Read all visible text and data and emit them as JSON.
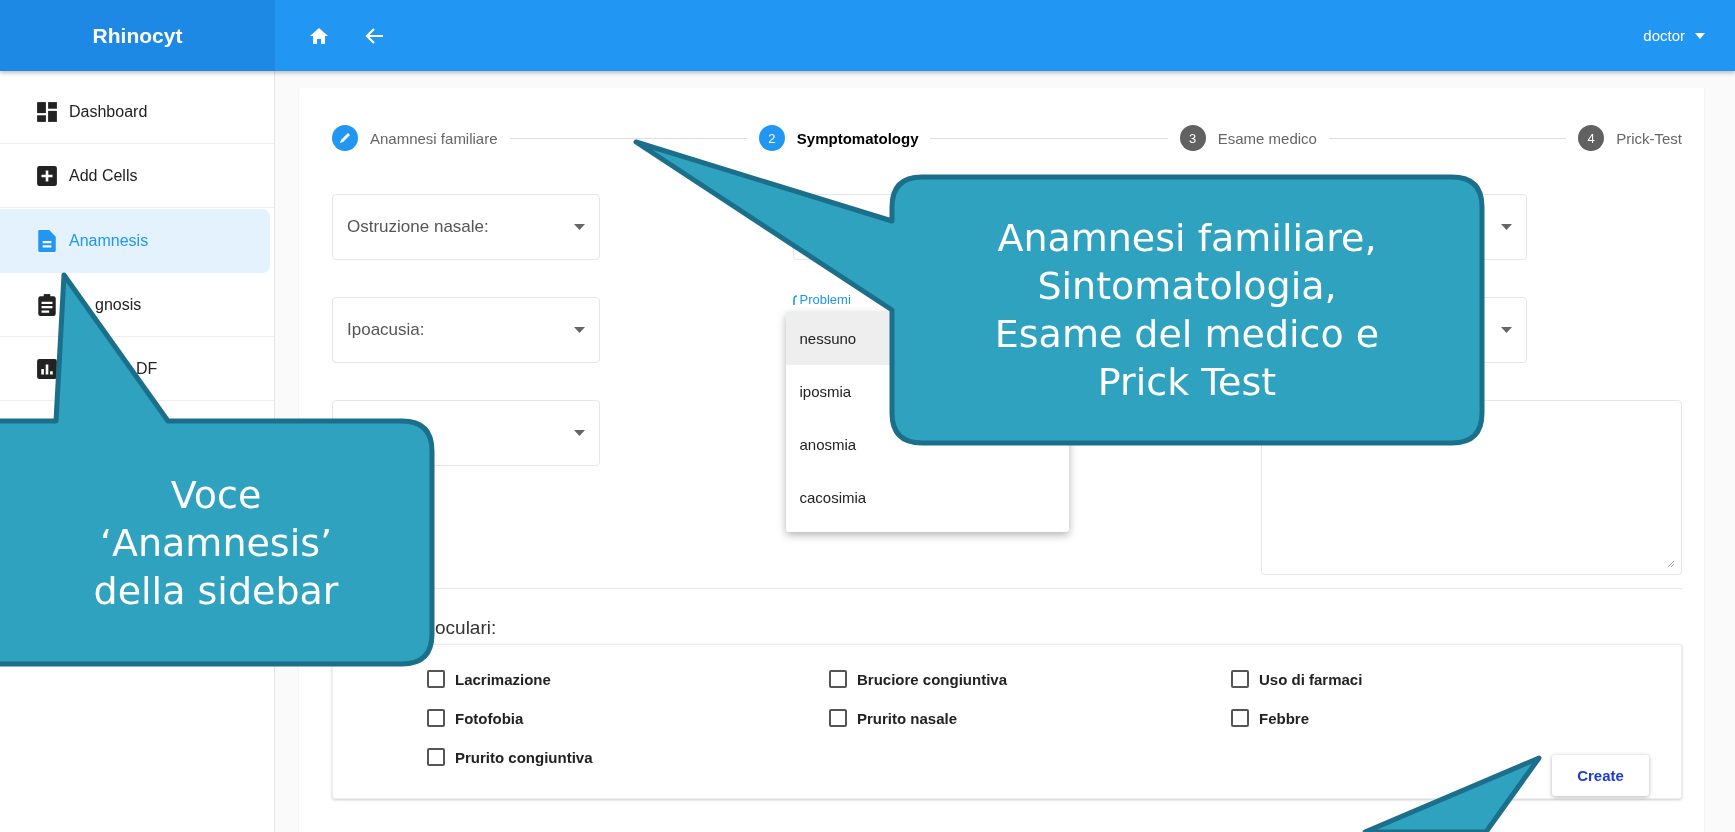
{
  "header": {
    "brand": "Rhinocyt",
    "user": "doctor"
  },
  "sidebar": {
    "items": [
      {
        "label": "Dashboard",
        "selected": false
      },
      {
        "label": "Add Cells",
        "selected": false
      },
      {
        "label": "Anamnesis",
        "selected": true
      },
      {
        "label": "gnosis",
        "selected": false
      },
      {
        "label": "DF",
        "selected": false
      }
    ]
  },
  "stepper": [
    {
      "label": "Anamnesi familiare",
      "kind": "done",
      "selected": false
    },
    {
      "label": "Symptomatology",
      "number": "2",
      "kind": "numbered",
      "selected": true
    },
    {
      "label": "Esame medico",
      "number": "3",
      "kind": "numbered",
      "selected": false
    },
    {
      "label": "Prick-Test",
      "number": "4",
      "kind": "numbered",
      "selected": false
    }
  ],
  "form": {
    "fields": [
      {
        "kind": "select",
        "label": "Ostruzione nasale:"
      },
      {
        "kind": "select"
      },
      {
        "kind": "select"
      },
      {
        "kind": "select",
        "label": "Ipoacusia:"
      },
      {
        "kind": "open-select",
        "label": "Problemi",
        "options": [
          {
            "label": "nessuno",
            "selected": true
          },
          {
            "label": "iposmia",
            "selected": false
          },
          {
            "label": "anosmia",
            "selected": false
          },
          {
            "label": "cacosimia",
            "selected": false
          }
        ]
      },
      {
        "kind": "select"
      },
      {
        "kind": "select"
      },
      {
        "kind": "textarea"
      }
    ]
  },
  "symptoms": {
    "label": "oculari:",
    "checkboxes": [
      {
        "label": "Lacrimazione",
        "checked": false
      },
      {
        "label": "Bruciore congiuntiva",
        "checked": false
      },
      {
        "label": "Uso di farmaci",
        "checked": false
      },
      {
        "label": "Fotofobia",
        "checked": false
      },
      {
        "label": "Prurito nasale",
        "checked": false
      },
      {
        "label": "Febbre",
        "checked": false
      },
      {
        "label": "Prurito congiuntiva",
        "checked": false
      }
    ],
    "button": "Create"
  },
  "callouts": [
    {
      "kind": "bubble",
      "text": "Anamnesi familiare,\nSintomatologia,\nEsame del medico e\nPrick Test"
    },
    {
      "kind": "bubble",
      "text": "Voce\n‘Anamnesis’\ndella sidebar"
    },
    {
      "kind": "pointer"
    }
  ]
}
